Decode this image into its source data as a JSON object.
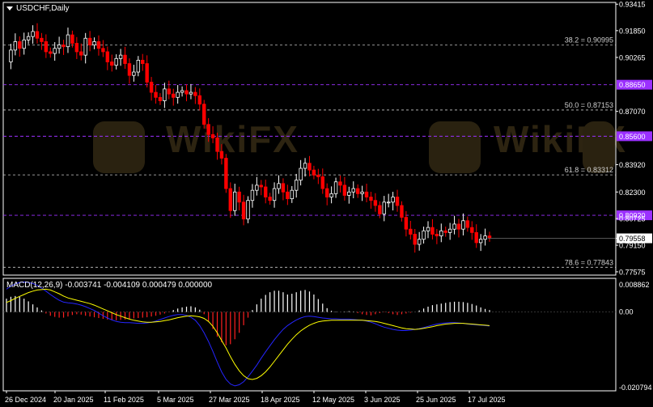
{
  "header": {
    "symbol_timeframe": "USDCHF,Daily"
  },
  "macd_panel": {
    "label": "MACD(12,26,9) -0.003741 -0.004109 0.000479 0.000000",
    "axis_labels": [
      "0.008862",
      "0.00",
      "-0.020794"
    ]
  },
  "watermark": {
    "text": "WikiFX"
  },
  "colors": {
    "background": "#000000",
    "bull_candle": "#ffffff",
    "bear_candle": "#ff0000",
    "grid": "#c8c8c8",
    "fib_line": "#c8c8c8",
    "pivot_line": "#9b30ff",
    "histogram_positive": "#ffffff",
    "histogram_negative": "#ff2020",
    "macd_line": "#2525ff",
    "signal_line": "#ffff00",
    "current_price_tag": "#ffffff"
  },
  "chart_data": {
    "type": "candlestick",
    "symbol": "USDCHF",
    "timeframe": "Daily",
    "price_axis_labels": [
      "0.93415",
      "0.91850",
      "0.90265",
      "0.88650",
      "0.87070",
      "0.85600",
      "0.83920",
      "0.82300",
      "0.80725",
      "0.79558",
      "0.79150",
      "0.77575"
    ],
    "ylim": [
      0.7738,
      0.9352
    ],
    "date_labels": [
      "26 Dec 2024",
      "20 Jan 2025",
      "11 Feb 2025",
      "5 Mar 2025",
      "27 Mar 2025",
      "18 Apr 2025",
      "12 May 2025",
      "3 Jun 2025",
      "25 Jun 2025",
      "17 Jul 2025"
    ],
    "current_price": 0.79558,
    "fibonacci_levels": [
      {
        "label": "38.2 = 0.90995",
        "value": 0.90995
      },
      {
        "label": "50.0 = 0.87153",
        "value": 0.87153
      },
      {
        "label": "61.8 = 0.83312",
        "value": 0.83312
      },
      {
        "label": "78.6 = 0.77843",
        "value": 0.77843
      }
    ],
    "pivot_levels": [
      {
        "label": "0.88650",
        "value": 0.8865
      },
      {
        "label": "0.85600",
        "value": 0.856
      },
      {
        "label": "0.80920",
        "value": 0.8092
      }
    ],
    "price_path": [
      0.9,
      0.907,
      0.912,
      0.908,
      0.913,
      0.915,
      0.918,
      0.914,
      0.912,
      0.906,
      0.905,
      0.908,
      0.91,
      0.909,
      0.916,
      0.911,
      0.906,
      0.904,
      0.914,
      0.91,
      0.912,
      0.908,
      0.906,
      0.9,
      0.898,
      0.902,
      0.904,
      0.899,
      0.892,
      0.894,
      0.901,
      0.899,
      0.888,
      0.882,
      0.879,
      0.877,
      0.884,
      0.881,
      0.879,
      0.882,
      0.883,
      0.881,
      0.882,
      0.88,
      0.875,
      0.863,
      0.857,
      0.855,
      0.847,
      0.843,
      0.825,
      0.812,
      0.823,
      0.817,
      0.807,
      0.818,
      0.824,
      0.827,
      0.826,
      0.82,
      0.818,
      0.825,
      0.828,
      0.823,
      0.819,
      0.824,
      0.83,
      0.837,
      0.84,
      0.836,
      0.833,
      0.832,
      0.825,
      0.82,
      0.822,
      0.829,
      0.827,
      0.821,
      0.823,
      0.825,
      0.822,
      0.823,
      0.82,
      0.818,
      0.815,
      0.81,
      0.817,
      0.817,
      0.82,
      0.815,
      0.808,
      0.801,
      0.798,
      0.792,
      0.795,
      0.8,
      0.802,
      0.798,
      0.797,
      0.8,
      0.799,
      0.801,
      0.804,
      0.801,
      0.806,
      0.802,
      0.799,
      0.793,
      0.795,
      0.797,
      0.796
    ],
    "macd": {
      "params": "12,26,9",
      "ylim": [
        -0.020794,
        0.008862
      ],
      "histogram": [
        0.0035,
        0.004,
        0.0042,
        0.004,
        0.0035,
        0.0028,
        0.002,
        0.0012,
        0.0004,
        -0.0004,
        -0.001,
        -0.0013,
        -0.0015,
        -0.0015,
        -0.0012,
        -0.0008,
        -0.0006,
        -0.0007,
        -0.001,
        -0.0012,
        -0.0014,
        -0.0016,
        -0.0018,
        -0.002,
        -0.0021,
        -0.0022,
        -0.0021,
        -0.002,
        -0.0018,
        -0.0017,
        -0.0016,
        -0.0015,
        -0.0014,
        -0.0012,
        -0.001,
        -0.0007,
        -0.0004,
        -0.0001,
        0.0005,
        0.0009,
        0.0012,
        0.0014,
        0.0015,
        0.0012,
        0.0006,
        -0.0006,
        -0.0025,
        -0.0045,
        -0.0065,
        -0.008,
        -0.0088,
        -0.0085,
        -0.0072,
        -0.0055,
        -0.0035,
        -0.0015,
        0.0005,
        0.002,
        0.0035,
        0.0045,
        0.0052,
        0.0056,
        0.0056,
        0.0052,
        0.0046,
        0.0048,
        0.0052,
        0.0056,
        0.0058,
        0.0054,
        0.0046,
        0.0034,
        0.0022,
        0.001,
        0.0003,
        0.0001,
        0.0,
        0.0001,
        0.0002,
        0.0001,
        -0.0003,
        -0.0006,
        -0.0008,
        -0.0009,
        -0.0006,
        -0.0003,
        -0.0001,
        -0.0003,
        -0.0006,
        -0.0008,
        -0.0006,
        -0.0004,
        -0.0002,
        0.0,
        0.0004,
        0.0009,
        0.0014,
        0.0018,
        0.002,
        0.0022,
        0.0024,
        0.0026,
        0.0027,
        0.0027,
        0.0026,
        0.0024,
        0.0021,
        0.0017,
        0.0012,
        0.0008,
        0.0005
      ],
      "macd_line": [
        0.006,
        0.0068,
        0.0074,
        0.0078,
        0.0079,
        0.0078,
        0.0075,
        0.007,
        0.0063,
        0.0055,
        0.0046,
        0.0038,
        0.0031,
        0.0026,
        0.0024,
        0.0023,
        0.0021,
        0.0018,
        0.0014,
        0.0009,
        0.0004,
        -0.0003,
        -0.001,
        -0.0016,
        -0.0021,
        -0.0025,
        -0.0027,
        -0.0028,
        -0.0028,
        -0.0029,
        -0.003,
        -0.003,
        -0.0029,
        -0.0027,
        -0.0024,
        -0.002,
        -0.0016,
        -0.0012,
        -0.0009,
        -0.0007,
        -0.0007,
        -0.0009,
        -0.0014,
        -0.0022,
        -0.0036,
        -0.0055,
        -0.0078,
        -0.0104,
        -0.0132,
        -0.0158,
        -0.0178,
        -0.019,
        -0.0195,
        -0.0192,
        -0.0184,
        -0.0171,
        -0.0156,
        -0.014,
        -0.0122,
        -0.0105,
        -0.0089,
        -0.0073,
        -0.0059,
        -0.0046,
        -0.0036,
        -0.0028,
        -0.0021,
        -0.0016,
        -0.0012,
        -0.0011,
        -0.0012,
        -0.0014,
        -0.0016,
        -0.0017,
        -0.0018,
        -0.0018,
        -0.0019,
        -0.0019,
        -0.0019,
        -0.002,
        -0.0021,
        -0.0022,
        -0.0024,
        -0.0027,
        -0.0031,
        -0.0036,
        -0.004,
        -0.0043,
        -0.0046,
        -0.0048,
        -0.0049,
        -0.0049,
        -0.0048,
        -0.0046,
        -0.0044,
        -0.0041,
        -0.0038,
        -0.0035,
        -0.0032,
        -0.003,
        -0.0029,
        -0.0028,
        -0.0028,
        -0.0029,
        -0.003,
        -0.0032,
        -0.0033,
        -0.0034,
        -0.0035,
        -0.0036,
        -0.0037
      ],
      "signal_line": [
        0.0025,
        0.003,
        0.0036,
        0.0041,
        0.0046,
        0.0051,
        0.0055,
        0.0058,
        0.0059,
        0.006,
        0.0058,
        0.0053,
        0.0048,
        0.0042,
        0.0037,
        0.0034,
        0.0031,
        0.0028,
        0.0025,
        0.0022,
        0.0018,
        0.0013,
        0.0008,
        0.0003,
        -0.0002,
        -0.0007,
        -0.0011,
        -0.0015,
        -0.0019,
        -0.0022,
        -0.0024,
        -0.0026,
        -0.0027,
        -0.0027,
        -0.0026,
        -0.0025,
        -0.0023,
        -0.0021,
        -0.0018,
        -0.0015,
        -0.0013,
        -0.0011,
        -0.001,
        -0.0011,
        -0.0013,
        -0.0017,
        -0.0025,
        -0.0038,
        -0.0055,
        -0.0075,
        -0.0095,
        -0.0118,
        -0.0138,
        -0.0155,
        -0.0168,
        -0.0176,
        -0.0178,
        -0.0175,
        -0.0168,
        -0.0158,
        -0.0145,
        -0.013,
        -0.0115,
        -0.01,
        -0.0085,
        -0.0072,
        -0.006,
        -0.005,
        -0.0042,
        -0.0035,
        -0.003,
        -0.0026,
        -0.0024,
        -0.0023,
        -0.0022,
        -0.0022,
        -0.0022,
        -0.0022,
        -0.0022,
        -0.0022,
        -0.0022,
        -0.0022,
        -0.0023,
        -0.0024,
        -0.0025,
        -0.0027,
        -0.003,
        -0.0033,
        -0.0036,
        -0.0039,
        -0.0042,
        -0.0044,
        -0.0045,
        -0.0046,
        -0.0045,
        -0.0043,
        -0.0041,
        -0.0039,
        -0.0036,
        -0.0034,
        -0.0032,
        -0.0031,
        -0.003,
        -0.003,
        -0.003,
        -0.0031,
        -0.0032,
        -0.0033,
        -0.0034,
        -0.0035,
        -0.0036
      ]
    }
  }
}
